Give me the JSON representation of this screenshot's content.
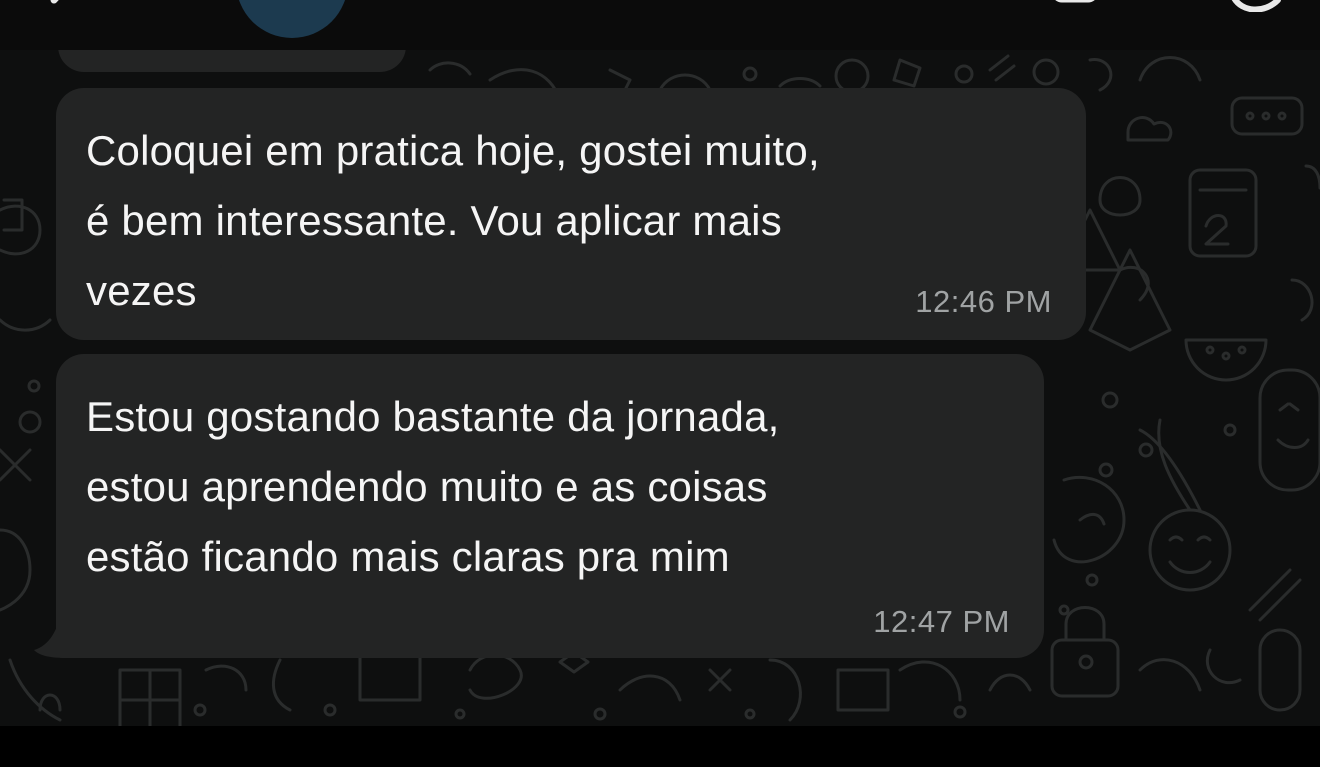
{
  "header": {
    "back_icon": "chevron-left-icon",
    "avatar_color": "#1c3a4f",
    "video_icon": "video-camera-icon",
    "call_icon": "phone-icon"
  },
  "colors": {
    "chat_background": "#0e0f0f",
    "bubble": "#232424",
    "message_text": "#f5f5f5",
    "timestamp": "#a0a3a4"
  },
  "messages": [
    {
      "lines": [
        "Coloquei em pratica hoje, gostei muito,",
        "é bem interessante. Vou aplicar mais",
        "vezes"
      ],
      "time": "12:46 PM"
    },
    {
      "lines": [
        "Estou gostando bastante da jornada,",
        "estou aprendendo muito e as coisas",
        "estão ficando mais claras pra mim"
      ],
      "time": "12:47 PM"
    }
  ]
}
